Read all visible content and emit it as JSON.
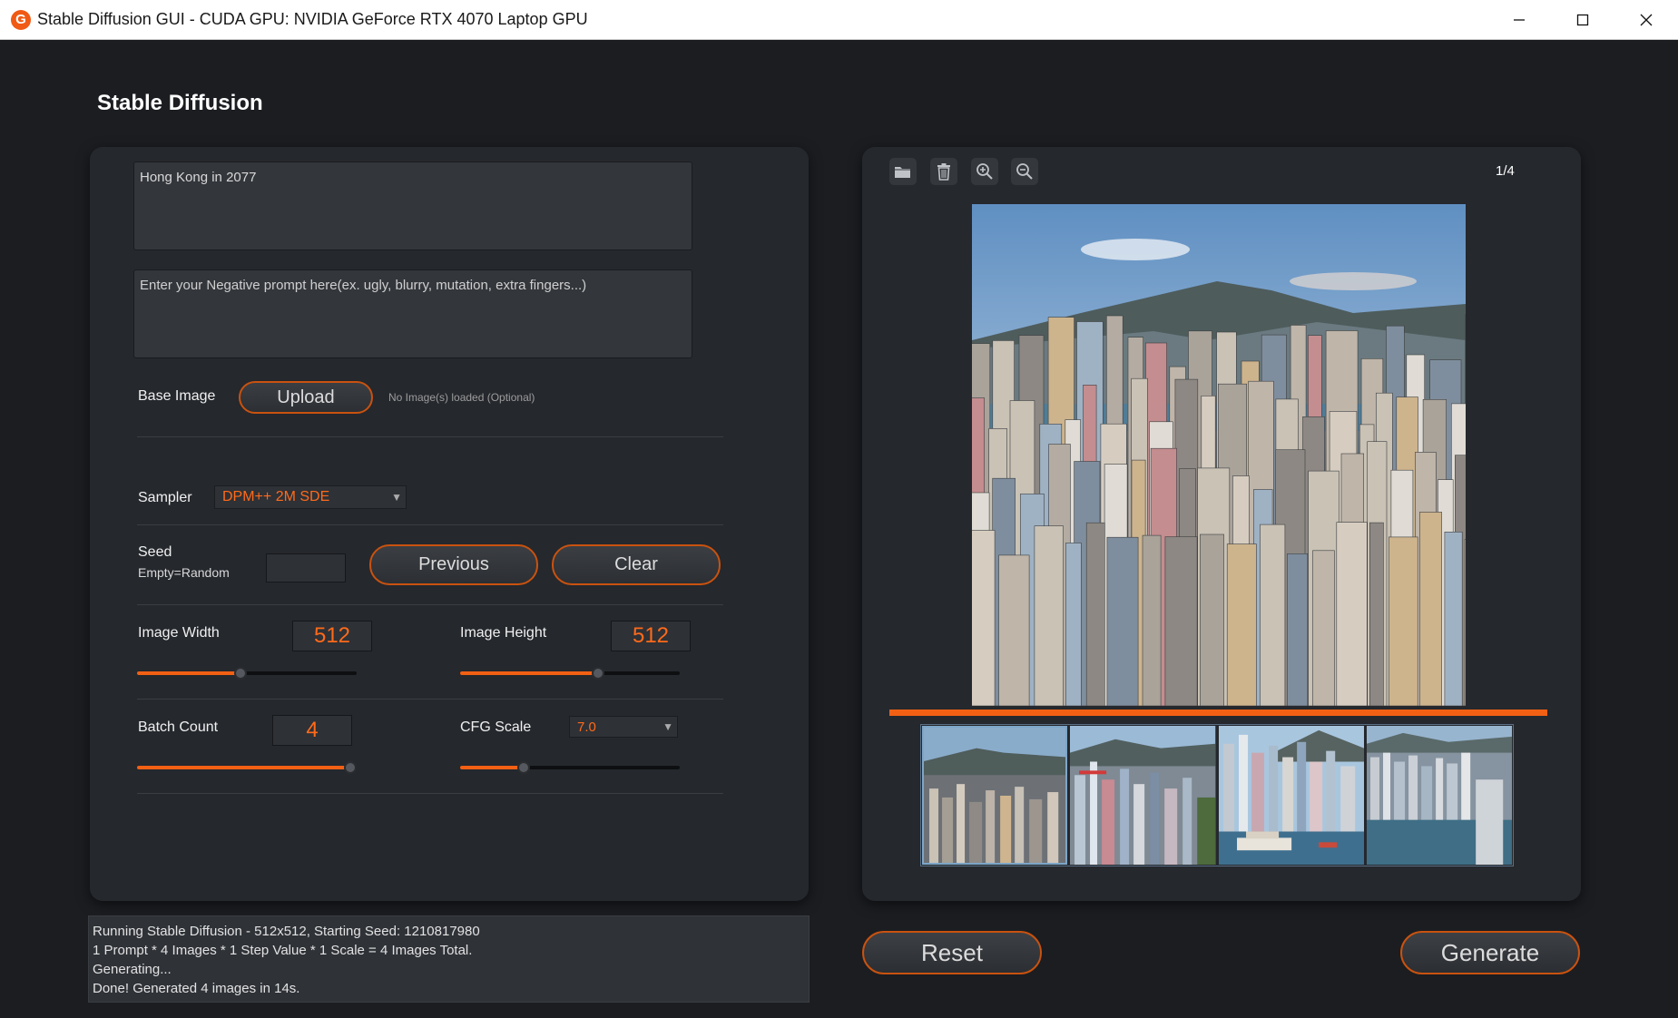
{
  "window": {
    "title": "Stable Diffusion GUI - CUDA GPU: NVIDIA GeForce RTX 4070 Laptop GPU",
    "logo_letter": "G",
    "controls": {
      "minimize": "—",
      "maximize": "☐",
      "close": "✕"
    }
  },
  "app": {
    "heading": "Stable Diffusion"
  },
  "prompt": {
    "value": "Hong Kong in 2077"
  },
  "negative_prompt": {
    "placeholder": "Enter your Negative prompt here(ex. ugly, blurry, mutation, extra fingers...)"
  },
  "base_image": {
    "label": "Base Image",
    "upload_label": "Upload",
    "status": "No Image(s) loaded (Optional)"
  },
  "sampler": {
    "label": "Sampler",
    "value": "DPM++ 2M SDE"
  },
  "seed": {
    "label": "Seed",
    "sublabel": "Empty=Random",
    "value": "",
    "previous_label": "Previous",
    "clear_label": "Clear"
  },
  "image_width": {
    "label": "Image Width",
    "value": "512",
    "slider_fraction": 0.47
  },
  "image_height": {
    "label": "Image Height",
    "value": "512",
    "slider_fraction": 0.63
  },
  "batch_count": {
    "label": "Batch Count",
    "value": "4",
    "slider_fraction": 0.97
  },
  "cfg_scale": {
    "label": "CFG Scale",
    "value": "7.0",
    "slider_fraction": 0.29
  },
  "log": {
    "lines": [
      "Running Stable Diffusion - 512x512, Starting Seed: 1210817980",
      "1 Prompt * 4 Images * 1 Step Value * 1 Scale = 4 Images Total.",
      "Generating...",
      "Done! Generated 4 images in 14s."
    ]
  },
  "viewer": {
    "page_counter": "1/4",
    "tools": [
      "folder-icon",
      "trash-icon",
      "zoom-in-icon",
      "zoom-out-icon"
    ],
    "progress_fraction": 1.0,
    "thumbnail_count": 4,
    "selected_thumbnail": 0
  },
  "actions": {
    "reset_label": "Reset",
    "generate_label": "Generate"
  },
  "colors": {
    "accent": "#f26014",
    "panel": "#25282d",
    "background": "#1b1d21"
  }
}
